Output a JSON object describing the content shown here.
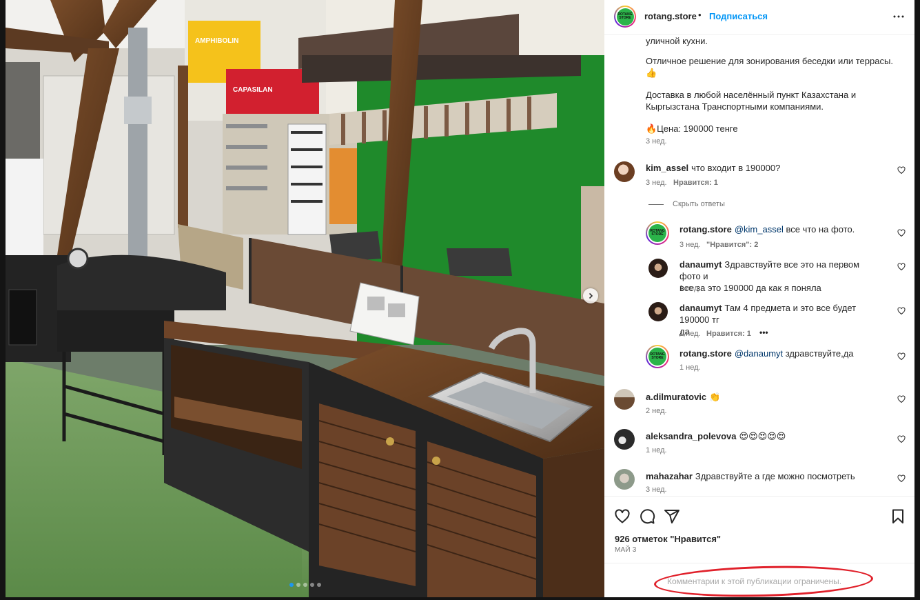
{
  "post": {
    "username": "rotang.store",
    "follow_label": "Подписаться",
    "header_separator": "•",
    "avatar_logo_text": "ROTANG STORE",
    "caption_lines": [
      "уличной кухни.",
      "Отличное решение для зонирования беседки или террасы.👍",
      "👍",
      "Доставка в любой населённый пункт Казахстана и",
      "Кыргызстана Транспортными компаниями.",
      "🔥Цена: 190000 тенге"
    ],
    "caption_time": "3 нед.",
    "likes": "926 отметок \"Нравится\"",
    "date": "МАЙ 3",
    "comments_restricted": "Комментарии к этой публикации ограничены."
  },
  "comments": [
    {
      "user": "kim_assel",
      "text": "что входит в 190000?",
      "time": "3 нед.",
      "likes": "Нравится: 1",
      "hide_replies": "Скрыть ответы",
      "replies": [
        {
          "user": "rotang.store",
          "mention": "@kim_assel",
          "text": " все что на фото.",
          "time": "3 нед.",
          "likes": "\"Нравится\": 2"
        },
        {
          "user": "danaumyt",
          "text": "Здравствуйте все это на первом фото и",
          "text2": "все за это 190000 да как я поняла",
          "time": "1 нед."
        },
        {
          "user": "danaumyt",
          "text": "Там 4 предмета и это все будет 190000 тг",
          "text2": "да",
          "time": "1 нед.",
          "likes": "Нравится: 1",
          "more": "•••"
        },
        {
          "user": "rotang.store",
          "mention": "@danaumyt",
          "text": " здравствуйте,да",
          "time": "1 нед."
        }
      ]
    },
    {
      "user": "a.dilmuratovic",
      "text": "👏",
      "time": "2 нед."
    },
    {
      "user": "aleksandra_polevova",
      "text": "😍😍😍😍😍",
      "time": "1 нед."
    },
    {
      "user": "mahazahar",
      "text": "Здравствуйте а где можно посмотреть",
      "time": "3 нед."
    }
  ],
  "photo": {
    "signs": [
      "AMPHIBOLIN",
      "CAPASILAN"
    ],
    "carousel_dots": 5,
    "carousel_active": 1
  },
  "colors": {
    "accent": "#0095f6",
    "highlight_ring": "#e0202a"
  }
}
